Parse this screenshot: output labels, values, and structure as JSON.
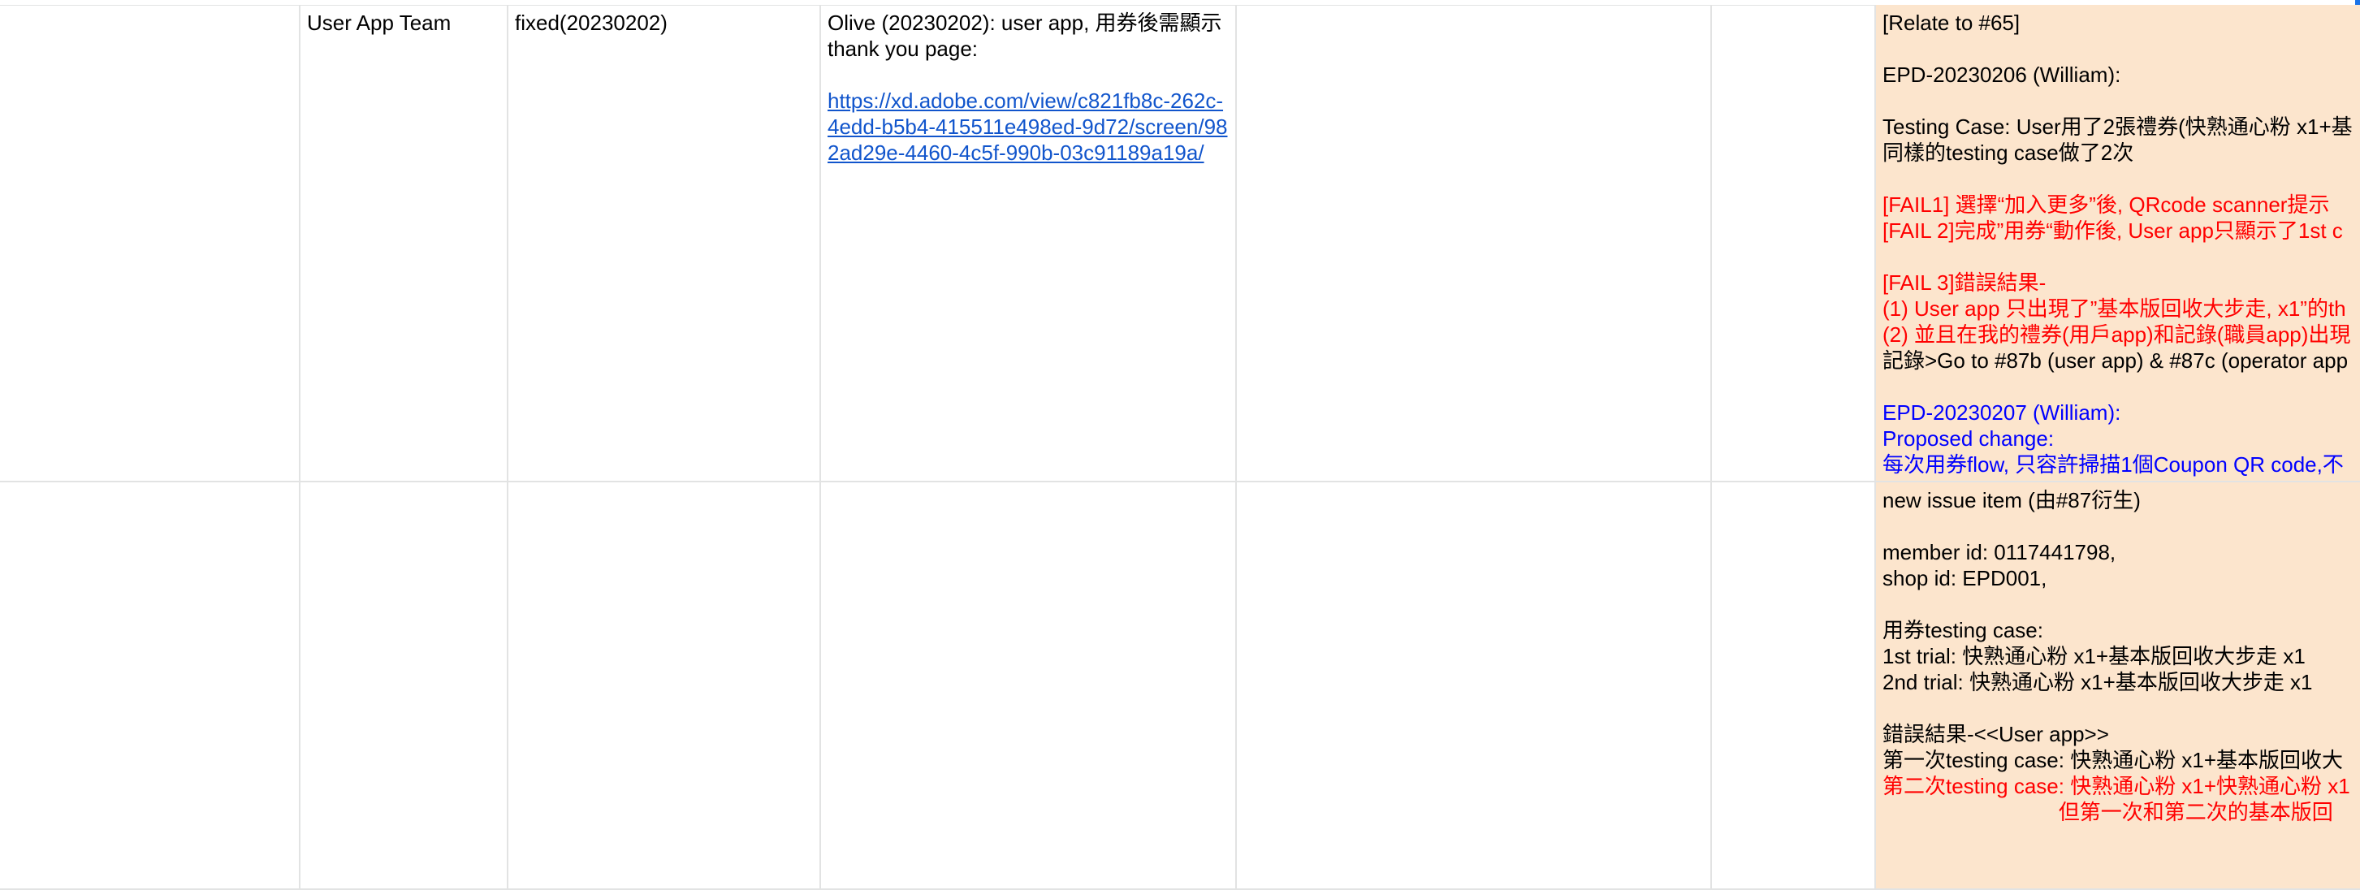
{
  "row1": {
    "team": "User App Team",
    "status": "fixed(20230202)",
    "note_text": "Olive (20230202): user app, 用券後需顯示 thank you page:",
    "note_link": "https://xd.adobe.com/view/c821fb8c-262c-4edd-b5b4-415511e498ed-9d72/screen/982ad29e-4460-4c5f-990b-03c91189a19a/",
    "detail_lines": [
      {
        "text": "[Relate to #65]",
        "color": "black"
      },
      {
        "text": "",
        "color": "black"
      },
      {
        "text": "EPD-20230206 (William):",
        "color": "black"
      },
      {
        "text": "",
        "color": "black"
      },
      {
        "text": "Testing Case: User用了2張禮券(快熟通心粉 x1+基",
        "color": "black"
      },
      {
        "text": "同樣的testing case做了2次",
        "color": "black"
      },
      {
        "text": "",
        "color": "black"
      },
      {
        "text": "[FAIL1] 選擇“加入更多”後, QRcode scanner提示",
        "color": "red"
      },
      {
        "text": "[FAIL 2]完成”用券“動作後, User app只顯示了1st c",
        "color": "red"
      },
      {
        "text": "",
        "color": "black"
      },
      {
        "text": "[FAIL 3]錯誤結果-",
        "color": "red"
      },
      {
        "text": "(1) User app 只出現了”基本版回收大步走, x1”的th",
        "color": "red"
      },
      {
        "text": "(2) 並且在我的禮券(用戶app)和記錄(職員app)出現",
        "color": "red"
      },
      {
        "text": "記錄>Go to #87b (user app) & #87c (operator app",
        "color": "black"
      },
      {
        "text": "",
        "color": "black"
      },
      {
        "text": "EPD-20230207 (William):",
        "color": "blue"
      },
      {
        "text": "Proposed change:",
        "color": "blue"
      },
      {
        "text": "每次用券flow, 只容許掃描1個Coupon QR code,不",
        "color": "blue"
      }
    ]
  },
  "row2": {
    "detail_lines": [
      {
        "text": "new issue item (由#87衍生)",
        "color": "black"
      },
      {
        "text": "",
        "color": "black"
      },
      {
        "text": "member id: 0117441798,",
        "color": "black"
      },
      {
        "text": "shop id: EPD001,",
        "color": "black"
      },
      {
        "text": "",
        "color": "black"
      },
      {
        "text": "用券testing case:",
        "color": "black"
      },
      {
        "text": "1st trial: 快熟通心粉 x1+基本版回收大步走 x1",
        "color": "black"
      },
      {
        "text": "2nd trial: 快熟通心粉 x1+基本版回收大步走 x1",
        "color": "black"
      },
      {
        "text": "",
        "color": "black"
      },
      {
        "text": "錯誤結果-<<User app>>",
        "color": "black"
      },
      {
        "text": "第一次testing case: 快熟通心粉 x1+基本版回收大",
        "color": "black"
      },
      {
        "text": "第二次testing case: 快熟通心粉 x1+快熟通心粉 x1",
        "color": "red"
      },
      {
        "text": "                              但第一次和第二次的基本版回",
        "color": "red"
      }
    ]
  },
  "colors": {
    "highlight_fill": "#fce5cd",
    "red_text": "#ff0000",
    "blue_text": "#0000ff",
    "link": "#1155cc",
    "gridline": "#e2e3e3"
  }
}
